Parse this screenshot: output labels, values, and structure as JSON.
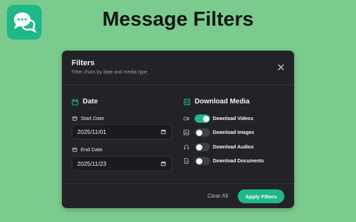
{
  "app": {
    "title": "Message Filters",
    "logo_icon": "chat-bubbles-icon",
    "accent": "#1fb888"
  },
  "dialog": {
    "title": "Filters",
    "subtitle": "Filter chats by date and media type",
    "close_icon": "close-icon"
  },
  "date_section": {
    "title": "Date",
    "start_label": "Start Date",
    "start_value": "2025/11/01",
    "end_label": "End Date",
    "end_value": "2025/11/23"
  },
  "media_section": {
    "title": "Download Media",
    "items": [
      {
        "label": "Download Videos",
        "icon": "video-icon",
        "enabled": true
      },
      {
        "label": "Download Images",
        "icon": "image-icon",
        "enabled": false
      },
      {
        "label": "Download Audios",
        "icon": "headphones-icon",
        "enabled": false
      },
      {
        "label": "Download Documents",
        "icon": "document-icon",
        "enabled": false
      }
    ]
  },
  "footer": {
    "clear_label": "Clear All",
    "apply_label": "Apply Filters"
  }
}
